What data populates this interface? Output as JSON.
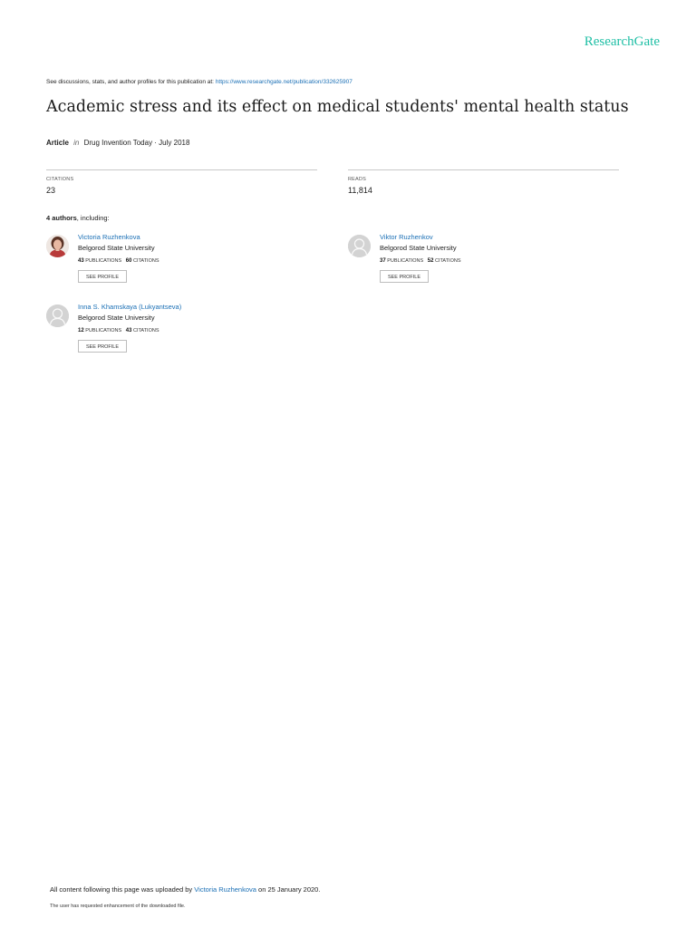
{
  "brand": "ResearchGate",
  "header": {
    "see_text": "See discussions, stats, and author profiles for this publication at:",
    "link": "https://www.researchgate.net/publication/332625907"
  },
  "title": "Academic stress and its effect on medical students' mental health status",
  "meta": {
    "type": "Article",
    "in": "in",
    "journal": "Drug Invention Today · July 2018"
  },
  "stats": {
    "citations_label": "CITATIONS",
    "citations_value": "23",
    "reads_label": "READS",
    "reads_value": "11,814"
  },
  "authors": {
    "count_text": "4 authors",
    "suffix": ", including:",
    "list": [
      {
        "name": "Victoria Ruzhenkova",
        "institution": "Belgorod State University",
        "publications": "43",
        "citations": "60"
      },
      {
        "name": "Viktor Ruzhenkov",
        "institution": "Belgorod State University",
        "publications": "37",
        "citations": "52"
      },
      {
        "name": "Inna S. Khamskaya (Lukyantseva)",
        "institution": "Belgorod State University",
        "publications": "12",
        "citations": "43"
      }
    ],
    "publications_label": "PUBLICATIONS",
    "citations_label": "CITATIONS",
    "see_profile": "SEE PROFILE"
  },
  "footer": {
    "prefix": "All content following this page was uploaded by",
    "uploader": "Victoria Ruzhenkova",
    "suffix": "on 25 January 2020.",
    "note": "The user has requested enhancement of the downloaded file."
  }
}
